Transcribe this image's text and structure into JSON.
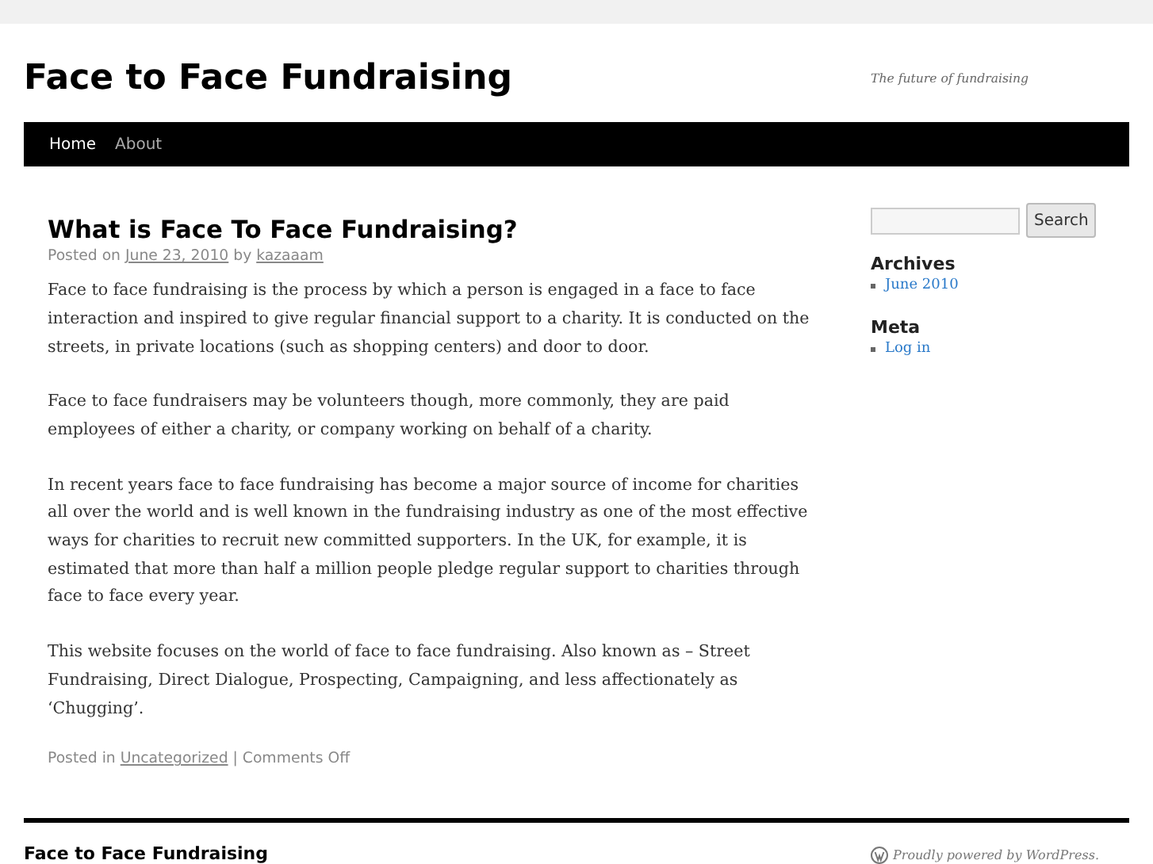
{
  "site": {
    "title": "Face to Face Fundraising",
    "tagline": "The future of fundraising"
  },
  "nav": [
    {
      "label": "Home",
      "selected": true
    },
    {
      "label": "About",
      "selected": false
    }
  ],
  "post": {
    "title": "What is Face To Face Fundraising?",
    "meta": {
      "prefix": "Posted on",
      "date": "June 23, 2010",
      "by": "by",
      "author": "kazaaam"
    },
    "paragraphs": [
      "Face to face fundraising is the process by which a person is engaged in a face to face interaction and inspired to give regular financial support to a charity. It is conducted on the streets, in private locations (such as shopping centers) and door to door.",
      "Face to face fundraisers may be volunteers though, more commonly, they are paid employees of either a charity, or company working on behalf of a charity.",
      "In recent years face to face fundraising has become a major source of income for charities all over the world and is well known in the fundraising industry as one of the most effective ways for charities to recruit new committed supporters. In the UK, for example, it is estimated that more than half a million people pledge regular support to charities through face to face every year.",
      "This website focuses on the world of face to face fundraising. Also known as – Street Fundraising, Direct Dialogue, Prospecting, Campaigning, and less affectionately as ‘Chugging’."
    ],
    "footer": {
      "prefix": "Posted in",
      "category": "Uncategorized",
      "separator": "|",
      "comments": "Comments Off"
    }
  },
  "sidebar": {
    "search_button": "Search",
    "widgets": [
      {
        "title": "Archives",
        "links": [
          "June 2010"
        ]
      },
      {
        "title": "Meta",
        "links": [
          "Log in"
        ]
      }
    ]
  },
  "footer": {
    "site_title": "Face to Face Fundraising",
    "credit": "Proudly powered by WordPress."
  }
}
